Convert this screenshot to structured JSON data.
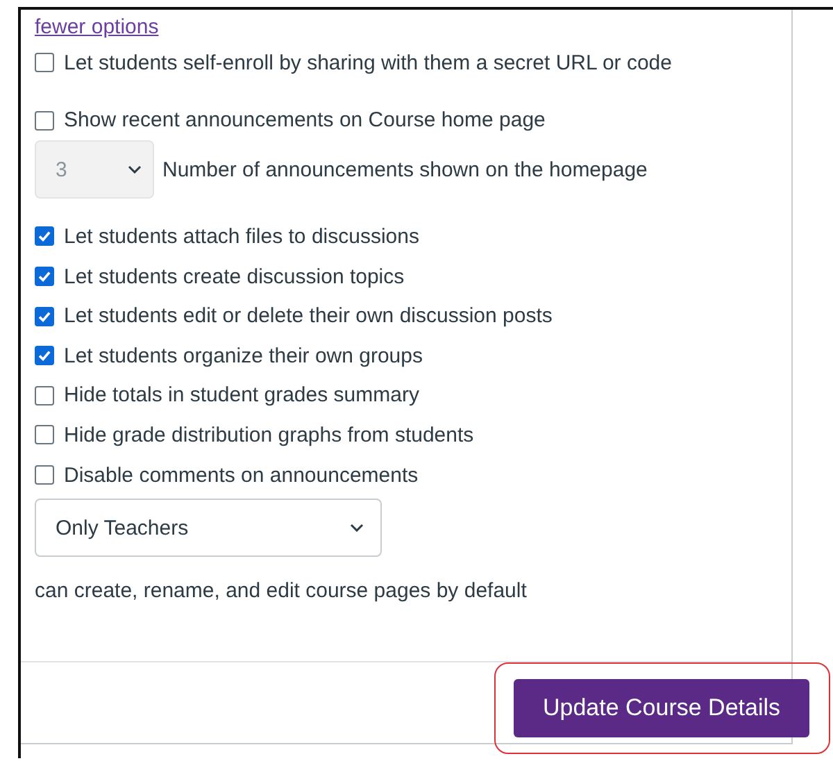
{
  "link": "fewer options",
  "groups": [
    {
      "items": [
        {
          "kind": "checkbox",
          "label": "Let students self-enroll by sharing with them a secret URL or code",
          "checked": false
        }
      ]
    },
    {
      "items": [
        {
          "kind": "checkbox",
          "label": "Show recent announcements on Course home page",
          "checked": false
        }
      ],
      "count_select": {
        "value": "3",
        "caption": "Number of announcements shown on the homepage",
        "disabled": true
      }
    },
    {
      "items": [
        {
          "kind": "checkbox",
          "label": "Let students attach files to discussions",
          "checked": true
        },
        {
          "kind": "checkbox",
          "label": "Let students create discussion topics",
          "checked": true
        },
        {
          "kind": "checkbox",
          "label": "Let students edit or delete their own discussion posts",
          "checked": true
        },
        {
          "kind": "checkbox",
          "label": "Let students organize their own groups",
          "checked": true
        },
        {
          "kind": "checkbox",
          "label": "Hide totals in student grades summary",
          "checked": false
        },
        {
          "kind": "checkbox",
          "label": "Hide grade distribution graphs from students",
          "checked": false
        },
        {
          "kind": "checkbox",
          "label": "Disable comments on announcements",
          "checked": false
        }
      ]
    }
  ],
  "pages_permission": {
    "value": "Only Teachers",
    "caption": "can create, rename, and edit course pages by default"
  },
  "submit": {
    "label": "Update Course Details",
    "highlighted": true
  }
}
